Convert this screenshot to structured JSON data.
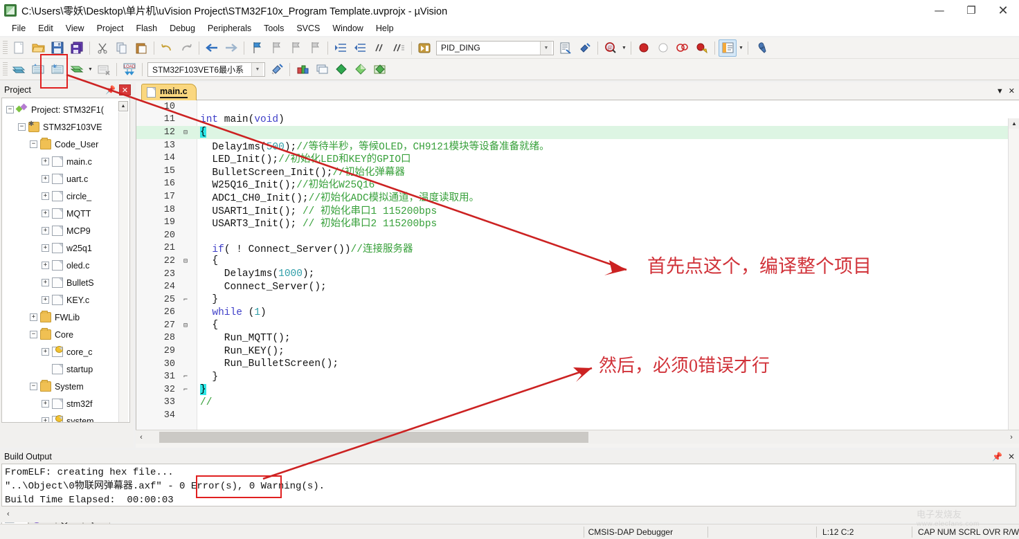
{
  "window": {
    "title": "C:\\Users\\零妖\\Desktop\\单片机\\uVision Project\\STM32F10x_Program Template.uvprojx - µVision",
    "minimize": "—",
    "maximize": "❐",
    "close": "✕"
  },
  "menu": [
    "File",
    "Edit",
    "View",
    "Project",
    "Flash",
    "Debug",
    "Peripherals",
    "Tools",
    "SVCS",
    "Window",
    "Help"
  ],
  "toolbar2": {
    "target_value": "STM32F103VET6最小系",
    "batch_value": "PID_DING"
  },
  "project_panel": {
    "title": "Project",
    "pin": "📌",
    "close": "✕",
    "tree": [
      {
        "indent": 0,
        "expander": "−",
        "icon": "project-root",
        "label": "Project: STM32F1("
      },
      {
        "indent": 1,
        "expander": "−",
        "icon": "target",
        "label": "STM32F103VE"
      },
      {
        "indent": 2,
        "expander": "−",
        "icon": "folder",
        "label": "Code_User"
      },
      {
        "indent": 3,
        "expander": "+",
        "icon": "file",
        "label": "main.c"
      },
      {
        "indent": 3,
        "expander": "+",
        "icon": "file",
        "label": "uart.c"
      },
      {
        "indent": 3,
        "expander": "+",
        "icon": "file",
        "label": "circle_"
      },
      {
        "indent": 3,
        "expander": "+",
        "icon": "file",
        "label": "MQTT"
      },
      {
        "indent": 3,
        "expander": "+",
        "icon": "file",
        "label": "MCP9"
      },
      {
        "indent": 3,
        "expander": "+",
        "icon": "file",
        "label": "w25q1"
      },
      {
        "indent": 3,
        "expander": "+",
        "icon": "file",
        "label": "oled.c"
      },
      {
        "indent": 3,
        "expander": "+",
        "icon": "file",
        "label": "BulletS"
      },
      {
        "indent": 3,
        "expander": "+",
        "icon": "file",
        "label": "KEY.c"
      },
      {
        "indent": 2,
        "expander": "+",
        "icon": "folder",
        "label": "FWLib"
      },
      {
        "indent": 2,
        "expander": "−",
        "icon": "folder",
        "label": "Core"
      },
      {
        "indent": 3,
        "expander": "+",
        "icon": "file-key",
        "label": "core_c"
      },
      {
        "indent": 3,
        "expander": "",
        "icon": "file",
        "label": "startup"
      },
      {
        "indent": 2,
        "expander": "−",
        "icon": "folder",
        "label": "System"
      },
      {
        "indent": 3,
        "expander": "+",
        "icon": "file",
        "label": "stm32f"
      },
      {
        "indent": 3,
        "expander": "+",
        "icon": "file-key",
        "label": "system"
      }
    ],
    "tabs": [
      {
        "label": "P..",
        "icon": "project-tab-icon",
        "selected": true
      },
      {
        "label": "B..",
        "icon": "books-tab-icon",
        "selected": false
      },
      {
        "label": "F..",
        "icon": "functions-tab-icon",
        "selected": false
      },
      {
        "label": "T..",
        "icon": "templates-tab-icon",
        "selected": false
      }
    ]
  },
  "editor": {
    "tab_label": "main.c",
    "lines": [
      {
        "no": "10",
        "fold": "",
        "html": "",
        "hl": false
      },
      {
        "no": "11",
        "fold": "",
        "html": "<span class=\"kw\">int</span> main(<span class=\"kw\">void</span>)",
        "hl": false
      },
      {
        "no": "12",
        "fold": "⊟",
        "html": "<span class=\"brace-hl\">{</span>",
        "hl": true
      },
      {
        "no": "13",
        "fold": "",
        "html": "  Delay1ms(<span class=\"num\">500</span>);<span class=\"cm\">//等待半秒，等候OLED，CH9121模块等设备准备就绪。</span>",
        "hl": false
      },
      {
        "no": "14",
        "fold": "",
        "html": "  LED_Init();<span class=\"cm\">//初始化LED和KEY的GPIO口</span>",
        "hl": false
      },
      {
        "no": "15",
        "fold": "",
        "html": "  BulletScreen_Init();<span class=\"cm\">//初始化弹幕器</span>",
        "hl": false
      },
      {
        "no": "16",
        "fold": "",
        "html": "  W25Q16_Init();<span class=\"cm\">//初始化W25Q16</span>",
        "hl": false
      },
      {
        "no": "17",
        "fold": "",
        "html": "  ADC1_CH0_Init();<span class=\"cm\">//初始化ADC模拟通道，温度读取用。</span>",
        "hl": false
      },
      {
        "no": "18",
        "fold": "",
        "html": "  USART1_Init(); <span class=\"cm\">// 初始化串口1 115200bps</span>",
        "hl": false
      },
      {
        "no": "19",
        "fold": "",
        "html": "  USART3_Init(); <span class=\"cm\">// 初始化串口2 115200bps</span>",
        "hl": false
      },
      {
        "no": "20",
        "fold": "",
        "html": "",
        "hl": false
      },
      {
        "no": "21",
        "fold": "",
        "html": "  <span class=\"kw\">if</span>( ! Connect_Server())<span class=\"cm\">//连接服务器</span>",
        "hl": false
      },
      {
        "no": "22",
        "fold": "⊟",
        "html": "  {",
        "hl": false
      },
      {
        "no": "23",
        "fold": "",
        "html": "    Delay1ms(<span class=\"num\">1000</span>);",
        "hl": false
      },
      {
        "no": "24",
        "fold": "",
        "html": "    Connect_Server();",
        "hl": false
      },
      {
        "no": "25",
        "fold": "⌐",
        "html": "  }",
        "hl": false
      },
      {
        "no": "26",
        "fold": "",
        "html": "  <span class=\"kw\">while</span> (<span class=\"num\">1</span>)",
        "hl": false
      },
      {
        "no": "27",
        "fold": "⊟",
        "html": "  {",
        "hl": false
      },
      {
        "no": "28",
        "fold": "",
        "html": "    Run_MQTT();",
        "hl": false
      },
      {
        "no": "29",
        "fold": "",
        "html": "    Run_KEY();",
        "hl": false
      },
      {
        "no": "30",
        "fold": "",
        "html": "    Run_BulletScreen();",
        "hl": false
      },
      {
        "no": "31",
        "fold": "⌐",
        "html": "  }",
        "hl": false
      },
      {
        "no": "32",
        "fold": "⌐",
        "html": "<span class=\"brace-hl\">}</span>",
        "hl": false
      },
      {
        "no": "33",
        "fold": "",
        "html": "<span class=\"cm\">//</span>",
        "hl": false
      },
      {
        "no": "34",
        "fold": "",
        "html": "",
        "hl": false
      }
    ]
  },
  "build_output": {
    "title": "Build Output",
    "pin": "📌",
    "close": "✕",
    "lines": [
      "FromELF: creating hex file...",
      "\"..\\Object\\0物联网弹幕器.axf\" - 0 Error(s), 0 Warning(s).",
      "Build Time Elapsed:  00:00:03"
    ],
    "scroll_left": "‹"
  },
  "status_bar": {
    "debugger": "CMSIS-DAP Debugger",
    "position": "L:12 C:2",
    "flags": "CAP NUM SCRL OVR R/W"
  },
  "annotations": {
    "note1": "首先点这个，编译整个项目",
    "note2": "然后，必须0错误才行"
  },
  "watermark": {
    "brand": "电子发烧友",
    "url": "www.elecfans.com"
  },
  "colors": {
    "annotation_red": "#d1333a",
    "highlight_box_red": "#e02020",
    "comment_green": "#37a03a",
    "keyword_blue": "#3e3ec8",
    "tab_yellow": "#fad77f",
    "current_line": "#ddf5e3"
  }
}
